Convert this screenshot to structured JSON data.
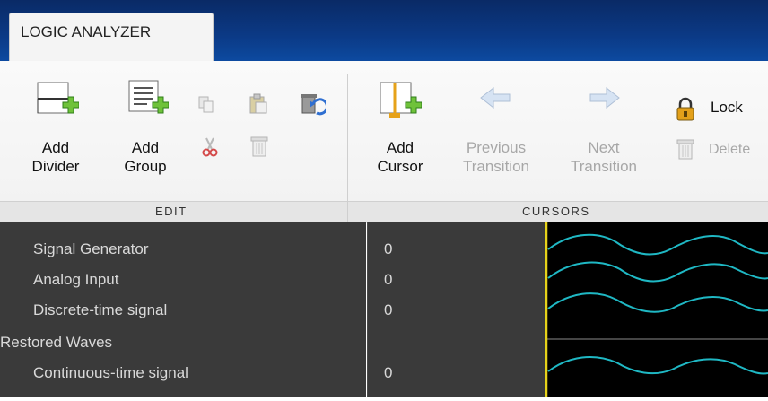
{
  "app": {
    "tab_title": "LOGIC ANALYZER"
  },
  "toolbar": {
    "edit": {
      "section_label": "EDIT",
      "add_divider": "Add\nDivider",
      "add_group": "Add\nGroup"
    },
    "cursors": {
      "section_label": "CURSORS",
      "add_cursor": "Add\nCursor",
      "previous_transition": "Previous\nTransition",
      "next_transition": "Next\nTransition",
      "lock": "Lock",
      "delete": "Delete"
    }
  },
  "signals": [
    {
      "name": "Signal Generator",
      "value": "0"
    },
    {
      "name": "Analog Input",
      "value": "0"
    },
    {
      "name": "Discrete-time signal",
      "value": "0"
    },
    {
      "name": "Restored Waves",
      "value": ""
    },
    {
      "name": "Continuous-time signal",
      "value": "0"
    }
  ],
  "colors": {
    "title_bar": "#0b3a86",
    "wave": "#1fb8c4",
    "cursor": "#e6d21a",
    "panel_bg": "#3a3a3a"
  }
}
